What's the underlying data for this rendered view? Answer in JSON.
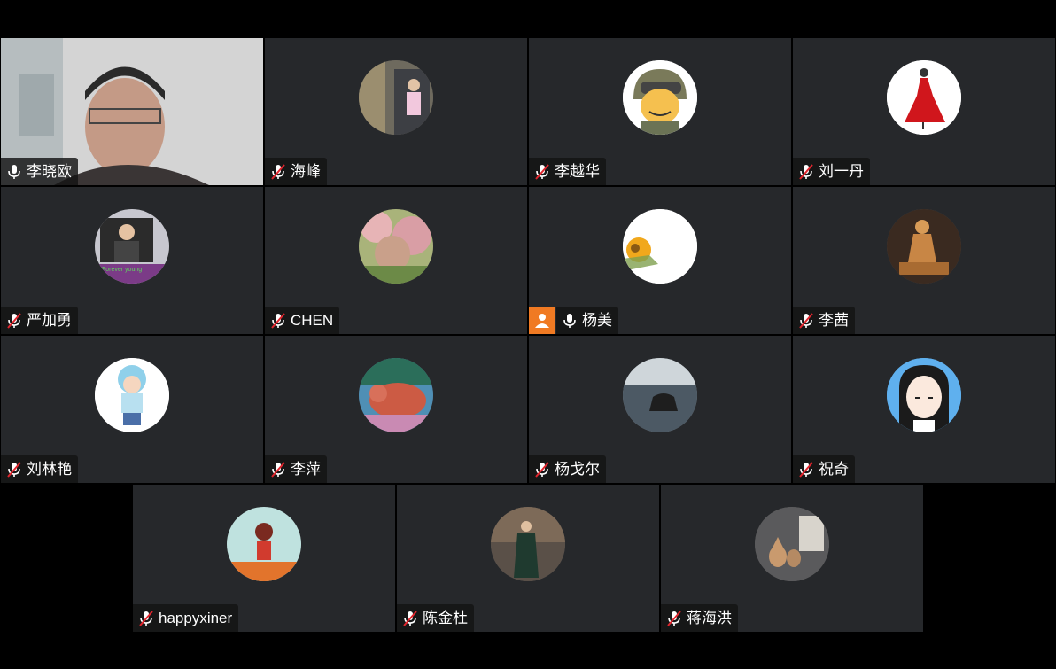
{
  "participants": [
    {
      "name": "李晓欧",
      "muted": false,
      "video": true
    },
    {
      "name": "海峰",
      "muted": true
    },
    {
      "name": "李越华",
      "muted": true
    },
    {
      "name": "刘一丹",
      "muted": true
    },
    {
      "name": "严加勇",
      "muted": true
    },
    {
      "name": "CHEN",
      "muted": true
    },
    {
      "name": "杨美",
      "muted": false,
      "host_badge": true
    },
    {
      "name": "李茜",
      "muted": true
    },
    {
      "name": "刘林艳",
      "muted": true
    },
    {
      "name": "李萍",
      "muted": true
    },
    {
      "name": "杨戈尔",
      "muted": true
    },
    {
      "name": "祝奇",
      "muted": true
    },
    {
      "name": "happyxiner",
      "muted": true
    },
    {
      "name": "陈金杜",
      "muted": true
    },
    {
      "name": "蒋海洪",
      "muted": true
    }
  ],
  "colors": {
    "active_border": "#2ecc71",
    "tile_bg": "#26282b",
    "host_badge": "#f07a23",
    "mute_red": "#e0252d"
  }
}
